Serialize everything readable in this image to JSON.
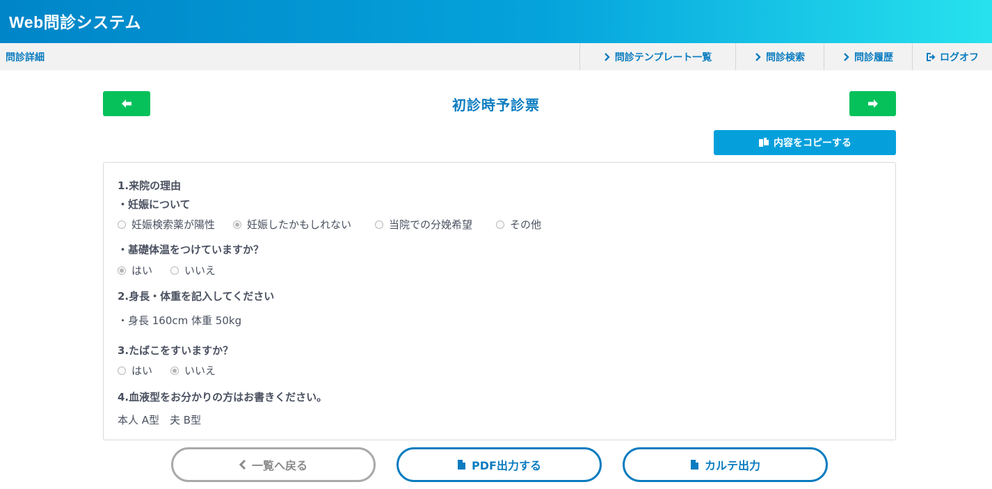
{
  "header": {
    "app_title": "Web問診システム"
  },
  "subnav": {
    "page_label": "問診詳細",
    "items": [
      {
        "label": "問診テンプレート一覧",
        "icon": "chevron-right-icon"
      },
      {
        "label": "問診検索",
        "icon": "chevron-right-icon"
      },
      {
        "label": "問診履歴",
        "icon": "chevron-right-icon"
      },
      {
        "label": "ログオフ",
        "icon": "logout-icon"
      }
    ]
  },
  "form": {
    "title": "初診時予診票",
    "prev_icon": "arrow-left-icon",
    "next_icon": "arrow-right-icon",
    "copy_label": "内容をコピーする",
    "copy_icon": "copy-icon"
  },
  "questions": {
    "q1": {
      "title": "1.来院の理由",
      "sub1": {
        "label": "・妊娠について",
        "options": [
          "妊娠検索薬が陽性",
          "妊娠したかもしれない",
          "当院での分娩希望",
          "その他"
        ],
        "selected_index": 1
      },
      "sub2": {
        "label": "・基礎体温をつけていますか？",
        "options": [
          "はい",
          "いいえ"
        ],
        "selected_index": 0
      }
    },
    "q2": {
      "title": "2.身長・体重を記入してください",
      "answer": "・身長 160cm  体重 50kg"
    },
    "q3": {
      "title": "3.たばこをすいますか？",
      "options": [
        "はい",
        "いいえ"
      ],
      "selected_index": 1
    },
    "q4": {
      "title": "4.血液型をお分かりの方はお書きください。",
      "answer": "本人 A型　夫 B型"
    }
  },
  "footer": {
    "back_label": "一覧へ戻る",
    "pdf_label": "PDF出力する",
    "karte_label": "カルテ出力"
  },
  "colors": {
    "accent": "#0a7cc0",
    "green": "#06c15a",
    "copy_button": "#05a0dc"
  }
}
